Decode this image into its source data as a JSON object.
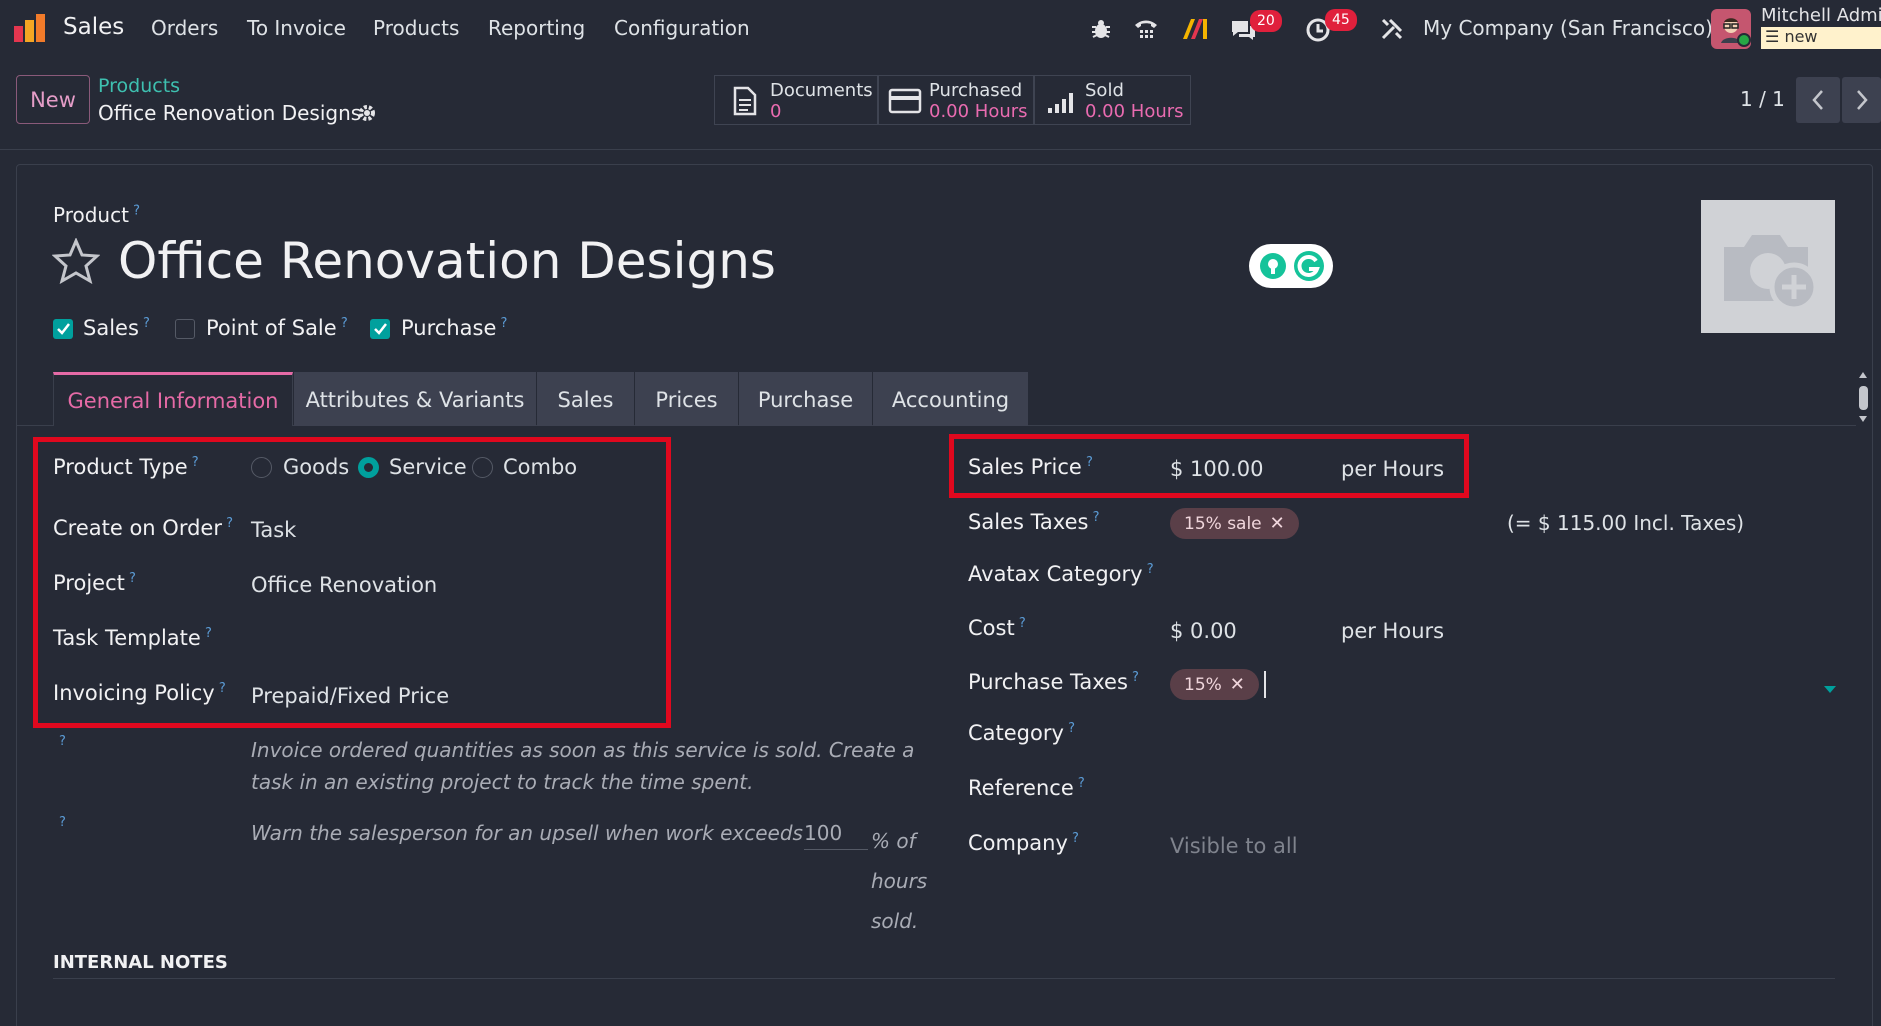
{
  "navbar": {
    "app_name": "Sales",
    "menu": [
      "Orders",
      "To Invoice",
      "Products",
      "Reporting",
      "Configuration"
    ],
    "messages_count": "20",
    "activities_count": "45",
    "company": "My Company (San Francisco)",
    "user_name": "Mitchell Admin",
    "db_badge": "new"
  },
  "control_panel": {
    "new_label": "New",
    "breadcrumb_parent": "Products",
    "breadcrumb_current": "Office Renovation Designs",
    "pager": "1 / 1",
    "smart_buttons": [
      {
        "label": "Documents",
        "value": "0"
      },
      {
        "label": "Purchased",
        "value": "0.00 Hours"
      },
      {
        "label": "Sold",
        "value": "0.00 Hours"
      }
    ]
  },
  "form": {
    "product_label": "Product",
    "product_name": "Office Renovation Designs",
    "checkboxes": [
      {
        "label": "Sales",
        "checked": true
      },
      {
        "label": "Point of Sale",
        "checked": false
      },
      {
        "label": "Purchase",
        "checked": true
      }
    ],
    "tabs": [
      "General Information",
      "Attributes & Variants",
      "Sales",
      "Prices",
      "Purchase",
      "Accounting"
    ],
    "left": {
      "product_type_label": "Product Type",
      "product_type_options": [
        "Goods",
        "Service",
        "Combo"
      ],
      "product_type_selected": "Service",
      "create_on_order_label": "Create on Order",
      "create_on_order_value": "Task",
      "project_label": "Project",
      "project_value": "Office Renovation",
      "task_template_label": "Task Template",
      "invoicing_policy_label": "Invoicing Policy",
      "invoicing_policy_value": "Prepaid/Fixed Price",
      "invoice_help": "Invoice ordered quantities as soon as this service is sold. Create a task in an existing project to track the time spent.",
      "upsell_prefix": "Warn the salesperson for an upsell when work exceeds",
      "upsell_value": "100",
      "upsell_suffix": "% of hours sold."
    },
    "right": {
      "sales_price_label": "Sales Price",
      "sales_price_value": "$ 100.00",
      "sales_price_unit": "per Hours",
      "sales_taxes_label": "Sales Taxes",
      "sales_taxes_tag": "15% sale",
      "incl_taxes": "(= $ 115.00 Incl. Taxes)",
      "avatax_label": "Avatax Category",
      "cost_label": "Cost",
      "cost_value": "$ 0.00",
      "cost_unit": "per Hours",
      "purchase_taxes_label": "Purchase Taxes",
      "purchase_taxes_tag": "15%",
      "category_label": "Category",
      "reference_label": "Reference",
      "company_label": "Company",
      "company_placeholder": "Visible to all"
    },
    "internal_notes": "INTERNAL NOTES"
  }
}
